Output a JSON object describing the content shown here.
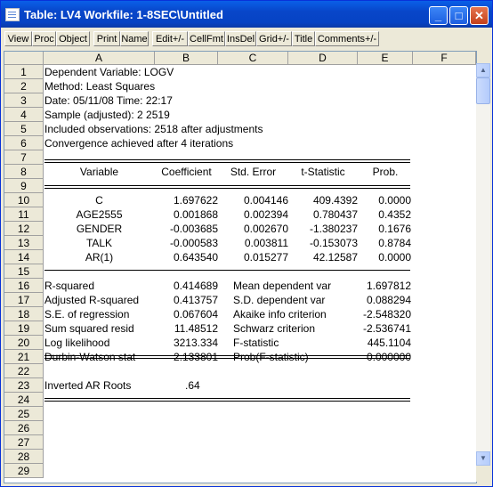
{
  "window": {
    "title": "Table: LV4   Workfile: 1-8SEC\\Untitled",
    "minimize": "_",
    "maximize": "□",
    "close": "✕"
  },
  "toolbar": [
    "View",
    "Proc",
    "Object",
    "Print",
    "Name",
    "Edit+/-",
    "CellFmt",
    "InsDel",
    "Grid+/-",
    "Title",
    "Comments+/-"
  ],
  "columns": [
    "A",
    "B",
    "C",
    "D",
    "E",
    "F"
  ],
  "row_numbers": [
    "1",
    "2",
    "3",
    "4",
    "5",
    "6",
    "7",
    "8",
    "9",
    "10",
    "11",
    "12",
    "13",
    "14",
    "15",
    "16",
    "17",
    "18",
    "19",
    "20",
    "21",
    "22",
    "23",
    "24",
    "25",
    "26",
    "27",
    "28",
    "29"
  ],
  "header_lines": [
    "Dependent Variable: LOGV",
    "Method: Least Squares",
    "Date: 05/11/08   Time: 22:17",
    "Sample (adjusted): 2 2519",
    "Included observations: 2518 after adjustments",
    "Convergence achieved after 4 iterations"
  ],
  "table_header": [
    "Variable",
    "Coefficient",
    "Std. Error",
    "t-Statistic",
    "Prob."
  ],
  "coefficients": [
    [
      "C",
      "1.697622",
      "0.004146",
      "409.4392",
      "0.0000"
    ],
    [
      "AGE2555",
      "0.001868",
      "0.002394",
      "0.780437",
      "0.4352"
    ],
    [
      "GENDER",
      "-0.003685",
      "0.002670",
      "-1.380237",
      "0.1676"
    ],
    [
      "TALK",
      "-0.000583",
      "0.003811",
      "-0.153073",
      "0.8784"
    ],
    [
      "AR(1)",
      "0.643540",
      "0.015277",
      "42.12587",
      "0.0000"
    ]
  ],
  "stats": [
    [
      "R-squared",
      "0.414689",
      "Mean dependent var",
      "1.697812"
    ],
    [
      "Adjusted R-squared",
      "0.413757",
      "S.D. dependent var",
      "0.088294"
    ],
    [
      "S.E. of regression",
      "0.067604",
      "Akaike info criterion",
      "-2.548320"
    ],
    [
      "Sum squared resid",
      "11.48512",
      "Schwarz criterion",
      "-2.536741"
    ],
    [
      "Log likelihood",
      "3213.334",
      "F-statistic",
      "445.1104"
    ],
    [
      "Durbin-Watson stat",
      "2.133801",
      "Prob(F-statistic)",
      "0.000000"
    ]
  ],
  "ar_roots": {
    "label": "Inverted AR Roots",
    "value": ".64"
  },
  "scrollbar": {
    "up": "▲",
    "down": "▼"
  }
}
